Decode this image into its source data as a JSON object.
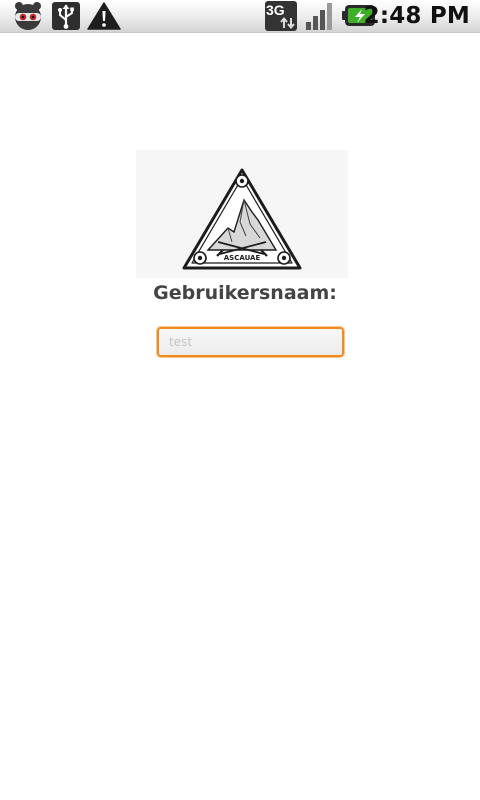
{
  "status_bar": {
    "time": "2:48 PM",
    "network_type": "3G",
    "icons": [
      "ninja-app-icon",
      "usb-icon",
      "warning-icon",
      "3g-data-icon",
      "signal-strength-icon",
      "battery-charging-icon"
    ]
  },
  "login": {
    "username_label": "Gebruikersnaam:",
    "username_value": "",
    "username_placeholder": "test"
  },
  "logo": {
    "text": "ASCAUAE"
  },
  "colors": {
    "input_focus_border": "#ef8c1f",
    "label_text": "#444444",
    "battery_green": "#3fae29"
  }
}
